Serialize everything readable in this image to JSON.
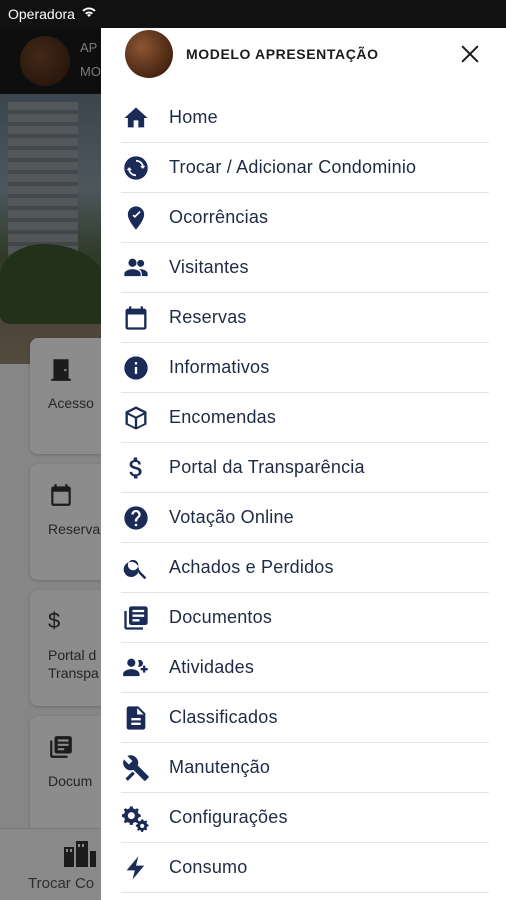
{
  "status_bar": {
    "carrier": "Operadora"
  },
  "background": {
    "header_lines": [
      "AP",
      "MO"
    ],
    "cards": [
      {
        "label": "Acesso"
      },
      {
        "label": "Reserva"
      },
      {
        "label": "Portal d\nTranspa"
      },
      {
        "label": "Docum"
      }
    ],
    "bottom_label": "Trocar Co"
  },
  "drawer": {
    "user_name": "MODELO APRESENTAÇÃO",
    "menu": [
      {
        "label": "Home",
        "icon": "home-icon"
      },
      {
        "label": "Trocar / Adicionar Condominio",
        "icon": "swap-icon"
      },
      {
        "label": "Ocorrências",
        "icon": "location-pin-icon"
      },
      {
        "label": "Visitantes",
        "icon": "people-icon"
      },
      {
        "label": "Reservas",
        "icon": "calendar-icon"
      },
      {
        "label": "Informativos",
        "icon": "info-icon"
      },
      {
        "label": "Encomendas",
        "icon": "package-icon"
      },
      {
        "label": "Portal da Transparência",
        "icon": "dollar-icon"
      },
      {
        "label": "Votação Online",
        "icon": "help-icon"
      },
      {
        "label": "Achados e Perdidos",
        "icon": "search-icon"
      },
      {
        "label": "Documentos",
        "icon": "documents-icon"
      },
      {
        "label": "Atividades",
        "icon": "add-people-icon"
      },
      {
        "label": "Classificados",
        "icon": "classifieds-icon"
      },
      {
        "label": "Manutenção",
        "icon": "tools-icon"
      },
      {
        "label": "Configurações",
        "icon": "gears-icon"
      },
      {
        "label": "Consumo",
        "icon": "lightning-icon"
      }
    ]
  }
}
